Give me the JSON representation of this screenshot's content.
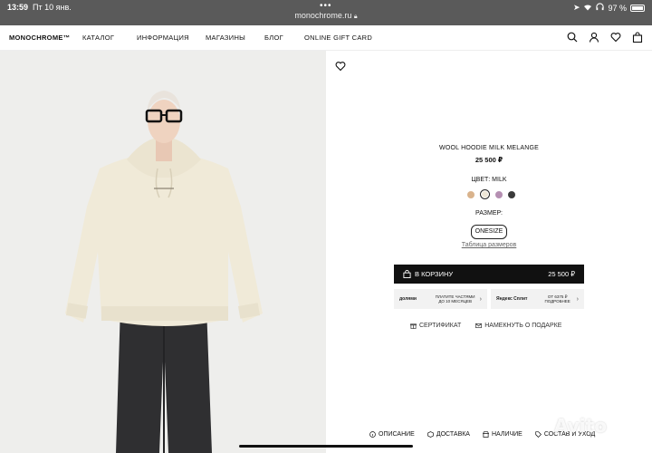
{
  "status_bar": {
    "time": "13:59",
    "date": "Пт 10 янв.",
    "url": "monochrome.ru",
    "battery": "97 %"
  },
  "header": {
    "logo": "MONOCHROME™",
    "nav": [
      "КАТАЛОГ",
      "ИНФОРМАЦИЯ",
      "МАГАЗИНЫ",
      "БЛОГ",
      "ONLINE GIFT CARD"
    ]
  },
  "product": {
    "name": "WOOL HOODIE MILK MELANGE",
    "price": "25 500 ₽",
    "color_label": "ЦВЕТ: MILK",
    "swatches": [
      {
        "color": "#d9b38c"
      },
      {
        "color": "#ede6d6",
        "selected": true
      },
      {
        "color": "#b58fb2"
      },
      {
        "color": "#3a3a3a"
      }
    ],
    "size_label": "РАЗМЕР:",
    "size_value": "ONESIZE",
    "size_table_link": "Таблица размеров",
    "cart_button_label": "В КОРЗИНУ",
    "cart_button_price": "25 500 ₽",
    "pay_dolyami": {
      "logo": "долями",
      "text": "ПЛАТИТЕ ЧАСТЯМИ ДО 10 МЕСЯЦЕВ"
    },
    "pay_split": {
      "logo": "Яндекс Сплит",
      "text": "ОТ 6375 ₽ ПОДРОБНЕЕ"
    },
    "certificate_link": "СЕРТИФИКАТ",
    "gift_hint_link": "НАМЕКНУТЬ О ПОДАРКЕ"
  },
  "bottom_links": [
    "ОПИСАНИЕ",
    "ДОСТАВКА",
    "НАЛИЧИЕ",
    "СОСТАВ И УХОД"
  ],
  "watermark": "Avito"
}
